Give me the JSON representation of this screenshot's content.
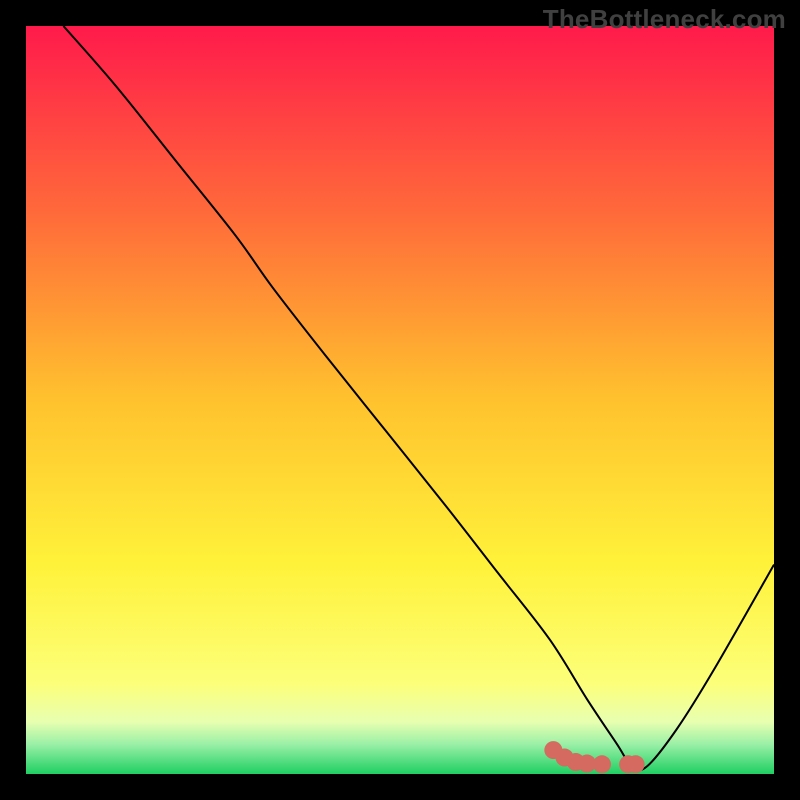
{
  "watermark": "TheBottleneck.com",
  "chart_data": {
    "type": "line",
    "title": "",
    "xlabel": "",
    "ylabel": "",
    "xlim": [
      0,
      100
    ],
    "ylim": [
      0,
      100
    ],
    "axes_visible": false,
    "grid": false,
    "background_gradient": {
      "stops": [
        {
          "offset": 0,
          "color": "#ff1a4b"
        },
        {
          "offset": 25,
          "color": "#ff6a3a"
        },
        {
          "offset": 50,
          "color": "#ffc22e"
        },
        {
          "offset": 72,
          "color": "#fff23a"
        },
        {
          "offset": 88,
          "color": "#fcff7a"
        },
        {
          "offset": 93,
          "color": "#e8ffb0"
        },
        {
          "offset": 96,
          "color": "#9bf0a7"
        },
        {
          "offset": 100,
          "color": "#1fcf63"
        }
      ]
    },
    "series": [
      {
        "name": "bottleneck-curve",
        "color": "#000000",
        "stroke_width": 2,
        "x": [
          5,
          12,
          20,
          28,
          33,
          40,
          48,
          56,
          63,
          70,
          75,
          79,
          81,
          83,
          87,
          92,
          100
        ],
        "y": [
          100,
          92,
          82,
          72,
          65,
          56,
          46,
          36,
          27,
          18,
          10,
          4,
          1,
          1,
          6,
          14,
          28
        ]
      },
      {
        "name": "highlight-dots",
        "type": "scatter",
        "color": "#d46a60",
        "marker_radius": 9,
        "x": [
          70.5,
          72.0,
          73.5,
          75.0,
          77.0,
          80.5,
          81.5
        ],
        "y": [
          3.2,
          2.2,
          1.6,
          1.4,
          1.3,
          1.3,
          1.3
        ]
      }
    ]
  }
}
